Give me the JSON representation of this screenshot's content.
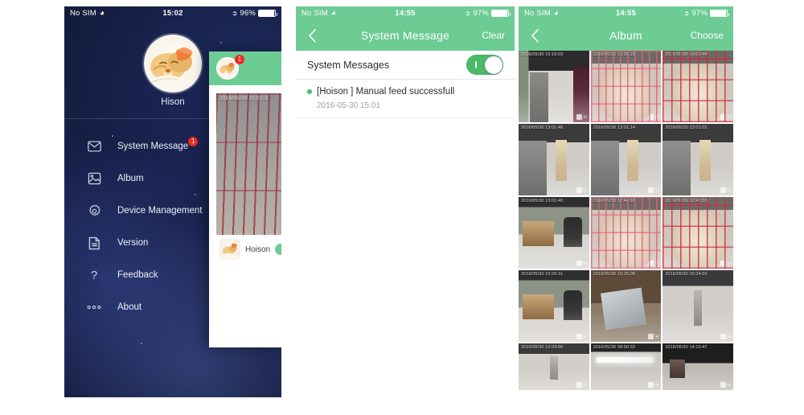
{
  "screen1": {
    "status_bar": {
      "carrier": "No SIM",
      "wifi_icon": "wifi-icon",
      "time": "15:02",
      "location_icon": "location-arrow-icon",
      "battery_text": "96%"
    },
    "profile": {
      "avatar_icon": "dog-avatar",
      "username": "Hison"
    },
    "menu": [
      {
        "label": "System Message",
        "icon": "envelope-icon",
        "badge": "1"
      },
      {
        "label": "Album",
        "icon": "photo-icon",
        "badge": ""
      },
      {
        "label": "Device Management",
        "icon": "gear-icon",
        "badge": ""
      },
      {
        "label": "Version",
        "icon": "document-icon",
        "badge": ""
      },
      {
        "label": "Feedback",
        "icon": "question-mark-icon",
        "badge": ""
      },
      {
        "label": "About",
        "icon": "ellipsis-icon",
        "badge": ""
      }
    ],
    "peek_card": {
      "avatar_icon": "dog-avatar",
      "badge": "1",
      "photo_timestamp": "2016/05/30 15:02:3",
      "device_name": "Hoison"
    }
  },
  "screen2": {
    "status_bar": {
      "carrier": "No SIM",
      "wifi_icon": "wifi-icon",
      "time": "14:55",
      "location_icon": "location-arrow-icon",
      "battery_text": "97%"
    },
    "navbar": {
      "back_icon": "chevron-left-icon",
      "title": "System Message",
      "action": "Clear"
    },
    "toggle_row": {
      "label": "System Messages",
      "state": "on"
    },
    "messages": [
      {
        "dot": "status-dot",
        "text": "[Hoison ] Manual feed successfull",
        "time": "2016-05-30  15:01"
      }
    ]
  },
  "screen3": {
    "status_bar": {
      "carrier": "No SIM",
      "wifi_icon": "wifi-icon",
      "time": "14:55",
      "location_icon": "location-arrow-icon",
      "battery_text": "97%"
    },
    "navbar": {
      "back_icon": "chevron-left-icon",
      "title": "Album",
      "action": "Choose"
    },
    "photos": [
      {
        "timestamp": "2016/05/30 15:19:03",
        "scene": "sc-hall",
        "watermark": "H"
      },
      {
        "timestamp": "2016/05/30 16:05:21",
        "scene": "sc-dog sc-cage-pink",
        "watermark": "H"
      },
      {
        "timestamp": "2016/05/30 16:08:44",
        "scene": "sc-dog sc-cage-red",
        "watermark": "H"
      },
      {
        "timestamp": "2016/05/30 13:01:46",
        "scene": "sc-corridor",
        "watermark": "H"
      },
      {
        "timestamp": "2016/05/30 13:01:14",
        "scene": "sc-corridor",
        "watermark": "H"
      },
      {
        "timestamp": "2016/05/30 13:01:02",
        "scene": "sc-corridor",
        "watermark": "H"
      },
      {
        "timestamp": "2016/05/30 13:01:40",
        "scene": "sc-office",
        "watermark": "H"
      },
      {
        "timestamp": "2016/05/30 12:44:18",
        "scene": "sc-dog sc-cage-pink",
        "watermark": "H"
      },
      {
        "timestamp": "2016/05/30 12:40:55",
        "scene": "sc-dog sc-cage-red",
        "watermark": "H"
      },
      {
        "timestamp": "2016/05/30 10:26:31",
        "scene": "sc-office",
        "watermark": "H"
      },
      {
        "timestamp": "2016/05/30 10:25:08",
        "scene": "sc-desk",
        "watermark": "H"
      },
      {
        "timestamp": "2016/05/30 10:24:02",
        "scene": "sc-floor",
        "watermark": "H"
      },
      {
        "timestamp": "2016/05/30 10:24:00",
        "scene": "sc-floor",
        "watermark": "H"
      },
      {
        "timestamp": "2016/05/30 09:50:33",
        "scene": "sc-lights",
        "watermark": "H"
      },
      {
        "timestamp": "2016/05/30 14:10:47",
        "scene": "sc-dark",
        "watermark": "H"
      }
    ]
  },
  "colors": {
    "green": "#6dcb94",
    "toggle_green": "#4cb96b",
    "badge_red": "#ee2b22",
    "navy": "#18204a"
  }
}
